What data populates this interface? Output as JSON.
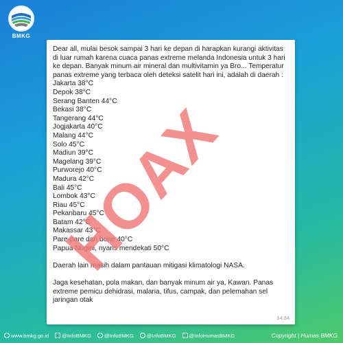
{
  "logo": {
    "text": "BMKG"
  },
  "message": {
    "intro": "Dear all, mulai besok sampai 3 hari ke depan di harapkan kurangi aktivitas di luar rumah karena cuaca panas extreme melanda Indonesia untuk 3 hari ke depan. Banyak minum air mineral dan multivitamin ya Bro... Temperatur panas extreme yang terbaca oleh deteksi satelit hari ini, adalah di daerah :",
    "list": [
      "Jakarta 38°C",
      "Depok 38°C",
      "Serang Banten 44°C",
      "Bekasi 38°C",
      "Tangerang 44°C",
      "Jogjakarta 40°C",
      "Malang 44°C",
      "Solo 45°C",
      "Madiun 39°C",
      "Magelang 39°C",
      "Purworejo 40°C",
      "Madura 42°C",
      "Bali 45°C",
      "Lombok 43°C",
      "Riau 45°C",
      "Pekanbaru 45°C",
      "Batam 42°C",
      "Makassar 43°C",
      "Pare-pare dan bone 40°C",
      "Papua Nugini, nyaris mendekati 50°C"
    ],
    "para2": "Daerah lain masih dalam pantauan mitigasi klimatologi NASA.",
    "para3": "Jaga kesehatan, pola makan, dan banyak minum air ya, Kawan. Panas extreme pemicu dehidrasi, malaria, tifus, campak, dan pelemahan sel jaringan otak",
    "time": "14:34"
  },
  "stamp": {
    "text": "HOAX",
    "color": "#f07878"
  },
  "footer": {
    "links": [
      {
        "icon": "globe-icon",
        "label": "www.bmkg.go.id"
      },
      {
        "icon": "instagram-icon",
        "label": "@InfoBMKG"
      },
      {
        "icon": "facebook-icon",
        "label": "@InfoBMKG"
      },
      {
        "icon": "twitter-icon",
        "label": "@InfoBMKG"
      },
      {
        "icon": "instagram-icon",
        "label": "@InfoHumasBMKG"
      }
    ],
    "copyright": "Copyright | Humas BMKG"
  }
}
